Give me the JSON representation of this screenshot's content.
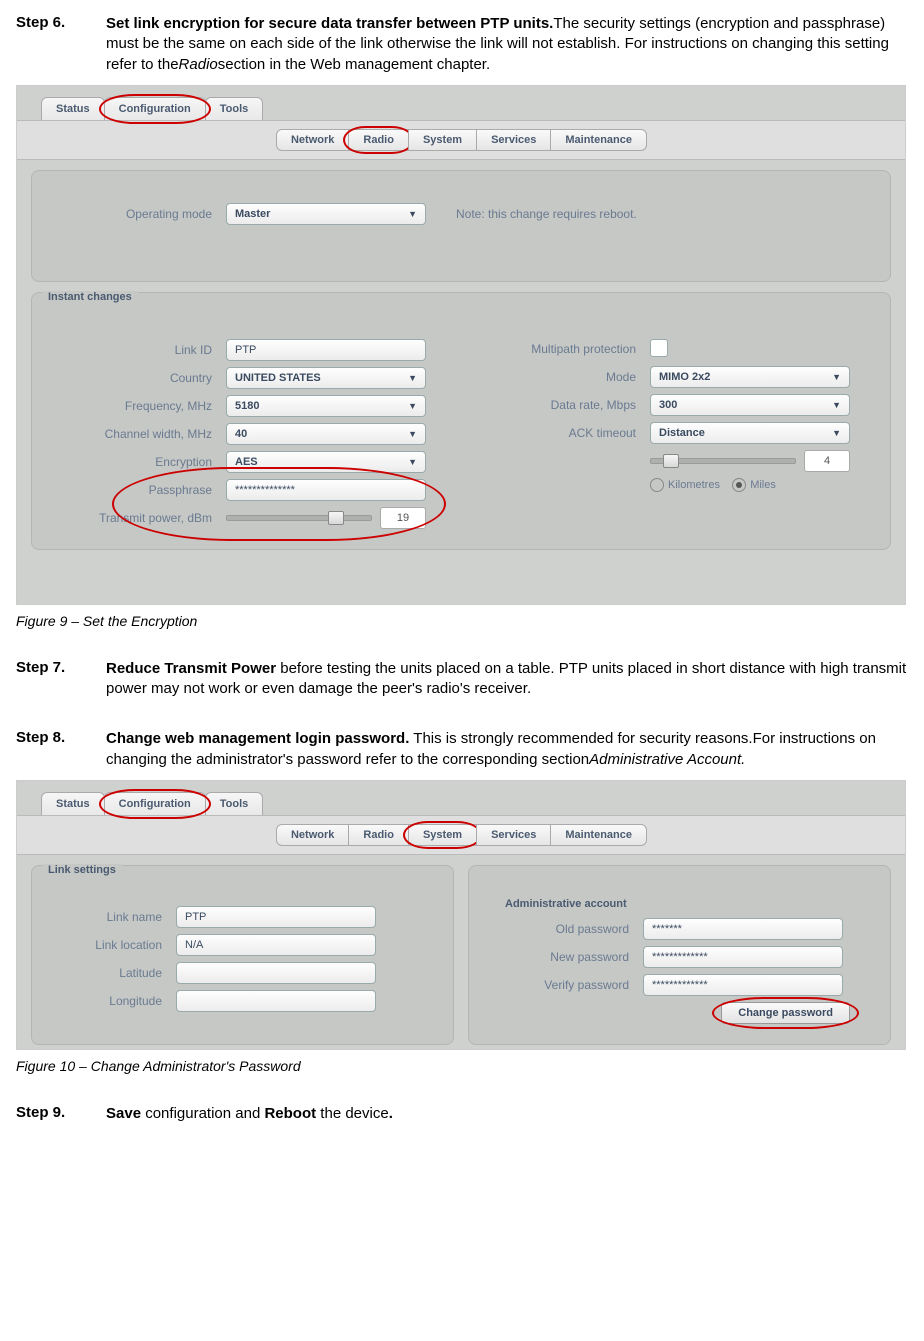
{
  "steps": {
    "s6": {
      "label": "Step 6.",
      "lead": "Set link encryption for secure data transfer between PTP units.",
      "rest1": "The security settings (encryption and passphrase) must be the same on each side of the link otherwise the link will not establish. For instructions on changing this setting refer to the",
      "ital": "Radio",
      "rest2": "section in the Web management chapter."
    },
    "s7": {
      "label": "Step 7.",
      "lead": "Reduce Transmit Power",
      "rest": " before testing the units placed on a table. PTP units placed in short distance with high transmit power may not work or even damage the peer's radio's receiver."
    },
    "s8": {
      "label": "Step 8.",
      "lead": "Change web management login password.",
      "rest1": " This is strongly recommended for security reasons.For instructions on changing the administrator's password refer to the corresponding section",
      "ital": "Administrative Account."
    },
    "s9": {
      "label": "Step 9.",
      "parts": [
        "Save",
        " configuration and ",
        "Reboot",
        " the device",
        "."
      ]
    }
  },
  "captions": {
    "fig9": "Figure 9 – Set the Encryption",
    "fig10": "Figure 10 – Change Administrator's Password"
  },
  "ui1": {
    "topTabs": [
      "Status",
      "Configuration",
      "Tools"
    ],
    "subTabs": [
      "Network",
      "Radio",
      "System",
      "Services",
      "Maintenance"
    ],
    "opMode": {
      "label": "Operating mode",
      "value": "Master",
      "note": "Note: this change requires reboot."
    },
    "instantTitle": "Instant changes",
    "left": {
      "linkId": {
        "label": "Link ID",
        "value": "PTP"
      },
      "country": {
        "label": "Country",
        "value": "UNITED STATES"
      },
      "freq": {
        "label": "Frequency, MHz",
        "value": "5180"
      },
      "chw": {
        "label": "Channel width, MHz",
        "value": "40"
      },
      "enc": {
        "label": "Encryption",
        "value": "AES"
      },
      "pass": {
        "label": "Passphrase",
        "value": "**************"
      },
      "txp": {
        "label": "Transmit power, dBm",
        "value": "19"
      }
    },
    "right": {
      "mp": {
        "label": "Multipath protection"
      },
      "mode": {
        "label": "Mode",
        "value": "MIMO 2x2"
      },
      "rate": {
        "label": "Data rate, Mbps",
        "value": "300"
      },
      "ack": {
        "label": "ACK timeout",
        "value": "Distance"
      },
      "dist": {
        "value": "4",
        "km": "Kilometres",
        "mi": "Miles"
      }
    }
  },
  "ui2": {
    "topTabs": [
      "Status",
      "Configuration",
      "Tools"
    ],
    "subTabs": [
      "Network",
      "Radio",
      "System",
      "Services",
      "Maintenance"
    ],
    "linkTitle": "Link settings",
    "adminTitle": "Administrative account",
    "left": {
      "name": {
        "label": "Link name",
        "value": "PTP"
      },
      "loc": {
        "label": "Link location",
        "value": "N/A"
      },
      "lat": {
        "label": "Latitude",
        "value": ""
      },
      "lon": {
        "label": "Longitude",
        "value": ""
      }
    },
    "right": {
      "old": {
        "label": "Old password",
        "value": "*******"
      },
      "new": {
        "label": "New password",
        "value": "*************"
      },
      "ver": {
        "label": "Verify password",
        "value": "*************"
      },
      "btn": "Change password"
    }
  }
}
